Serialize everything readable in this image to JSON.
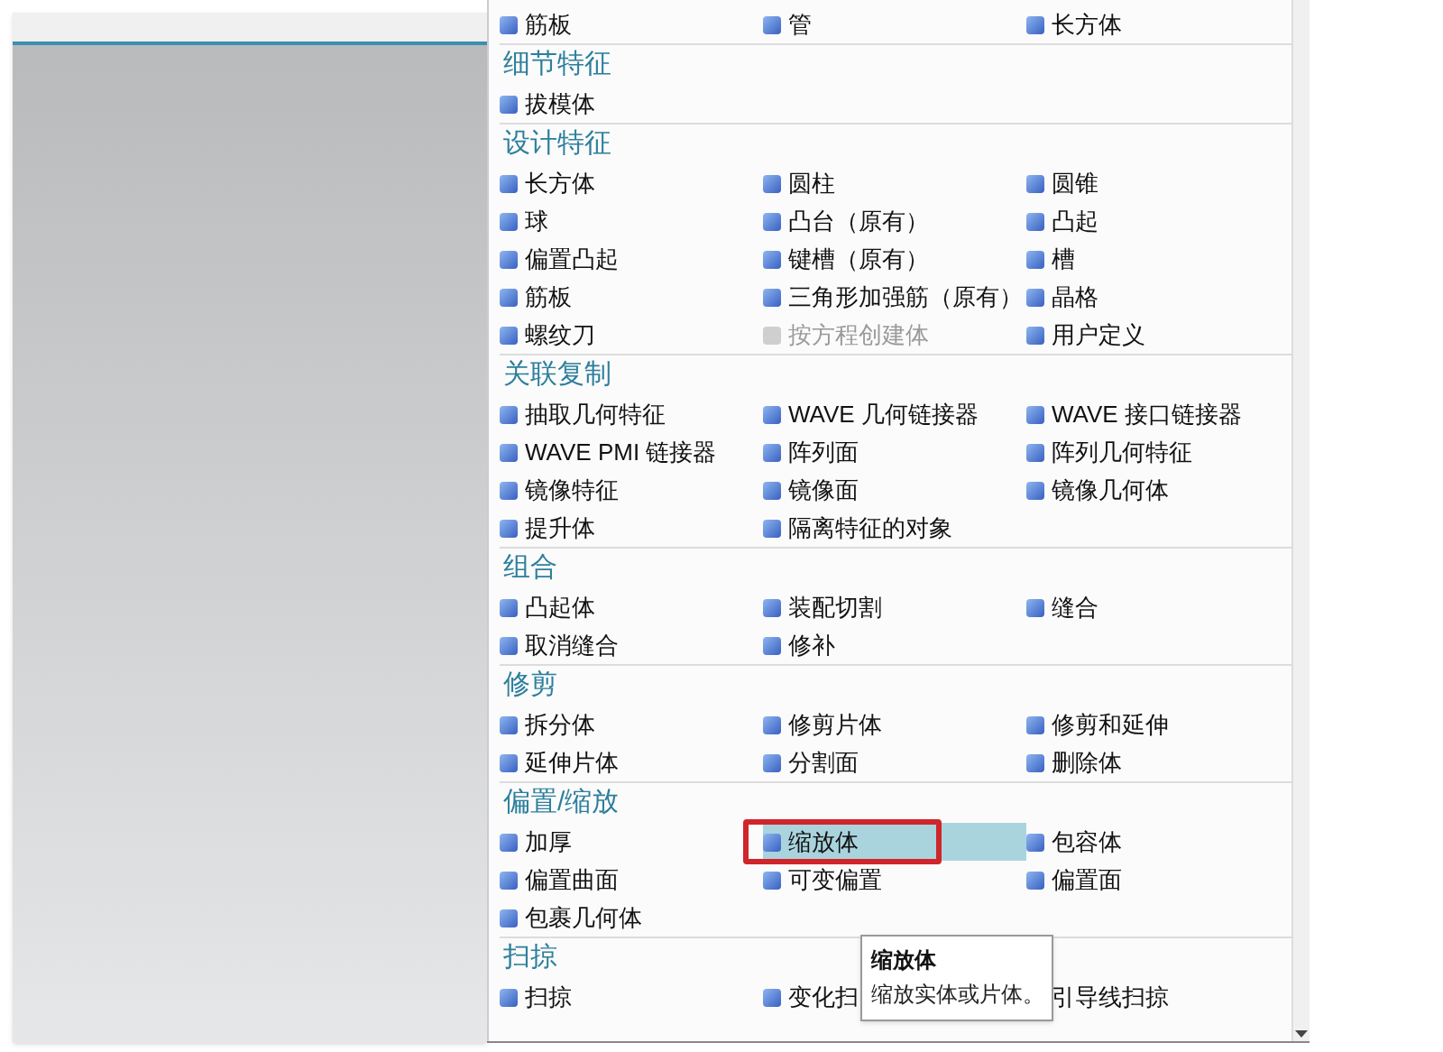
{
  "menu": {
    "sections": [
      {
        "items": [
          {
            "label": "筋板",
            "selected": false,
            "disabled": false
          },
          {
            "label": "管",
            "selected": false,
            "disabled": false
          },
          {
            "label": "长方体",
            "selected": false,
            "disabled": false
          }
        ]
      },
      {
        "title": "细节特征",
        "items": [
          {
            "label": "拔模体",
            "selected": false,
            "disabled": false
          }
        ]
      },
      {
        "title": "设计特征",
        "items": [
          {
            "label": "长方体",
            "selected": false,
            "disabled": false
          },
          {
            "label": "圆柱",
            "selected": false,
            "disabled": false
          },
          {
            "label": "圆锥",
            "selected": false,
            "disabled": false
          },
          {
            "label": "球",
            "selected": false,
            "disabled": false
          },
          {
            "label": "凸台（原有）",
            "selected": false,
            "disabled": false
          },
          {
            "label": "凸起",
            "selected": false,
            "disabled": false
          },
          {
            "label": "偏置凸起",
            "selected": false,
            "disabled": false
          },
          {
            "label": "键槽（原有）",
            "selected": false,
            "disabled": false
          },
          {
            "label": "槽",
            "selected": false,
            "disabled": false
          },
          {
            "label": "筋板",
            "selected": false,
            "disabled": false
          },
          {
            "label": "三角形加强筋（原有）",
            "selected": false,
            "disabled": false
          },
          {
            "label": "晶格",
            "selected": false,
            "disabled": false
          },
          {
            "label": "螺纹刀",
            "selected": false,
            "disabled": false
          },
          {
            "label": "按方程创建体",
            "selected": false,
            "disabled": true
          },
          {
            "label": "用户定义",
            "selected": false,
            "disabled": false
          }
        ]
      },
      {
        "title": "关联复制",
        "items": [
          {
            "label": "抽取几何特征",
            "selected": false,
            "disabled": false
          },
          {
            "label": "WAVE 几何链接器",
            "selected": false,
            "disabled": false
          },
          {
            "label": "WAVE 接口链接器",
            "selected": false,
            "disabled": false
          },
          {
            "label": "WAVE PMI 链接器",
            "selected": false,
            "disabled": false
          },
          {
            "label": "阵列面",
            "selected": false,
            "disabled": false
          },
          {
            "label": "阵列几何特征",
            "selected": false,
            "disabled": false
          },
          {
            "label": "镜像特征",
            "selected": false,
            "disabled": false
          },
          {
            "label": "镜像面",
            "selected": false,
            "disabled": false
          },
          {
            "label": "镜像几何体",
            "selected": false,
            "disabled": false
          },
          {
            "label": "提升体",
            "selected": false,
            "disabled": false
          },
          {
            "label": "隔离特征的对象",
            "selected": false,
            "disabled": false
          }
        ]
      },
      {
        "title": "组合",
        "items": [
          {
            "label": "凸起体",
            "selected": false,
            "disabled": false
          },
          {
            "label": "装配切割",
            "selected": false,
            "disabled": false
          },
          {
            "label": "缝合",
            "selected": false,
            "disabled": false
          },
          {
            "label": "取消缝合",
            "selected": false,
            "disabled": false
          },
          {
            "label": "修补",
            "selected": false,
            "disabled": false
          }
        ]
      },
      {
        "title": "修剪",
        "items": [
          {
            "label": "拆分体",
            "selected": false,
            "disabled": false
          },
          {
            "label": "修剪片体",
            "selected": false,
            "disabled": false
          },
          {
            "label": "修剪和延伸",
            "selected": false,
            "disabled": false
          },
          {
            "label": "延伸片体",
            "selected": false,
            "disabled": false
          },
          {
            "label": "分割面",
            "selected": false,
            "disabled": false
          },
          {
            "label": "删除体",
            "selected": false,
            "disabled": false
          }
        ]
      },
      {
        "title": "偏置/缩放",
        "items": [
          {
            "label": "加厚",
            "selected": false,
            "disabled": false
          },
          {
            "label": "缩放体",
            "selected": true,
            "disabled": false
          },
          {
            "label": "包容体",
            "selected": false,
            "disabled": false
          },
          {
            "label": "偏置曲面",
            "selected": false,
            "disabled": false
          },
          {
            "label": "可变偏置",
            "selected": false,
            "disabled": false
          },
          {
            "label": "偏置面",
            "selected": false,
            "disabled": false
          },
          {
            "label": "包裹几何体",
            "selected": false,
            "disabled": false
          }
        ]
      },
      {
        "title": "扫掠",
        "items": [
          {
            "label": "扫掠",
            "selected": false,
            "disabled": false
          },
          {
            "label": "变化扫",
            "selected": false,
            "disabled": false
          },
          {
            "label": "引导线扫掠",
            "selected": false,
            "disabled": false
          }
        ]
      }
    ]
  },
  "tooltip": {
    "title": "缩放体",
    "text": "缩放实体或片体。"
  }
}
